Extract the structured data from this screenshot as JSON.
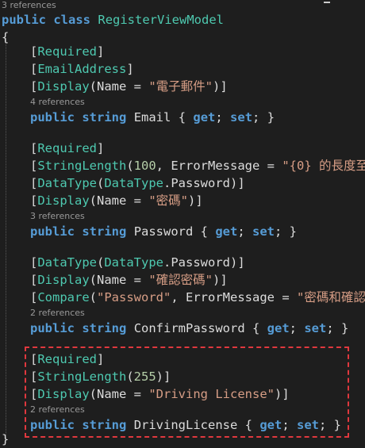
{
  "refs": {
    "class": "3 references",
    "email": "4 references",
    "password": "3 references",
    "confirm": "2 references",
    "driving": "2 references"
  },
  "class_decl": {
    "keyword_public": "public",
    "keyword_class": "class",
    "name": "RegisterViewModel"
  },
  "braces": {
    "open": "{",
    "close": "}"
  },
  "tokens": {
    "public": "public",
    "string": "string",
    "get": "get",
    "set": "set",
    "name_param": "Name",
    "error_param": "ErrorMessage",
    "datatype_enum": "DataType",
    "password_member": "Password"
  },
  "email": {
    "attr_required": "Required",
    "attr_email": "EmailAddress",
    "attr_display": "Display",
    "display_value": "\"電子郵件\"",
    "prop_name": "Email"
  },
  "password": {
    "attr_required": "Required",
    "attr_stringlength": "StringLength",
    "length": "100",
    "error_value": "\"{0} 的長度至",
    "attr_datatype": "DataType",
    "attr_display": "Display",
    "display_value": "\"密碼\"",
    "prop_name": "Password"
  },
  "confirm": {
    "attr_datatype": "DataType",
    "attr_display": "Display",
    "display_value": "\"確認密碼\"",
    "attr_compare": "Compare",
    "compare_value": "\"Password\"",
    "error_value": "\"密碼和確認",
    "prop_name": "ConfirmPassword"
  },
  "driving": {
    "attr_required": "Required",
    "attr_stringlength": "StringLength",
    "length": "255",
    "attr_display": "Display",
    "display_value": "\"Driving License\"",
    "prop_name": "DrivingLicense"
  },
  "colors": {
    "background": "#1e1e1e",
    "keyword": "#569cd6",
    "type_attr": "#4ec9b0",
    "string": "#d69d85",
    "number": "#b5cea8",
    "plain": "#dcdcdc",
    "codelens": "#999999",
    "highlight_border": "#e0383e"
  }
}
